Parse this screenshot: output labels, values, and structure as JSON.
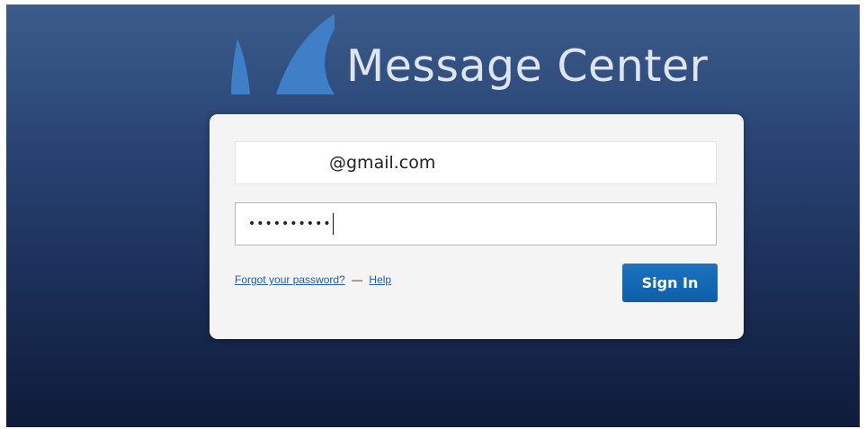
{
  "header": {
    "title": "Message Center",
    "logo_icon": "sail-icon",
    "logo_color": "#3f7fc8"
  },
  "login": {
    "email_value": "@gmail.com",
    "password_value": "••••••••••",
    "forgot_link": "Forgot your password?",
    "separator": "—",
    "help_link": "Help",
    "signin_label": "Sign In"
  },
  "colors": {
    "accent": "#1666b0",
    "background_top": "#3b5c8c",
    "background_bottom": "#0f1b3a"
  }
}
